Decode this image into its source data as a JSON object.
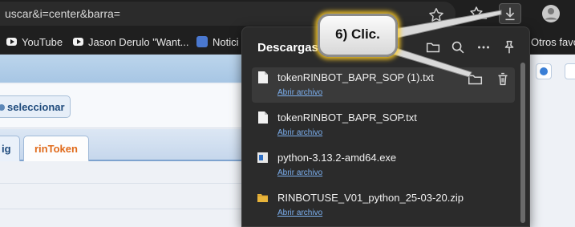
{
  "browser": {
    "url_text": "uscar&i=center&barra=",
    "bookmarks": [
      {
        "label": "YouTube",
        "icon": "youtube-icon"
      },
      {
        "label": "Jason Derulo \"Want...",
        "icon": "youtube-icon"
      },
      {
        "label": "Notici",
        "icon": "news-icon"
      },
      {
        "label": "Otros favor",
        "icon": "folder-icon"
      }
    ],
    "toolbar_icons": [
      "star-icon",
      "favorites-icon",
      "download-icon",
      "profile-icon"
    ]
  },
  "page": {
    "select_button_label": "seleccionar",
    "tabs": [
      {
        "label": "ig",
        "active": false
      },
      {
        "label": "rinToken",
        "active": true
      }
    ],
    "accent_color": "#e06a1a"
  },
  "downloads": {
    "title": "Descargas",
    "header_icons": [
      "folder-icon",
      "search-icon",
      "more-icon",
      "pin-icon"
    ],
    "items": [
      {
        "name": "tokenRINBOT_BAPR_SOP (1).txt",
        "link": "Abrir archivo",
        "icon": "text-file-icon",
        "highlighted": true
      },
      {
        "name": "tokenRINBOT_BAPR_SOP.txt",
        "link": "Abrir archivo",
        "icon": "text-file-icon",
        "highlighted": false
      },
      {
        "name": "python-3.13.2-amd64.exe",
        "link": "Abrir archivo",
        "icon": "exe-file-icon",
        "highlighted": false
      },
      {
        "name": "RINBOTUSE_V01_python_25-03-20.zip",
        "link": "Abrir archivo",
        "icon": "zip-folder-icon",
        "highlighted": false
      }
    ],
    "row_actions": [
      "open-folder-icon",
      "delete-icon"
    ]
  },
  "callout": {
    "text": "6) Clic.",
    "glow_color": "#ffcd28"
  }
}
